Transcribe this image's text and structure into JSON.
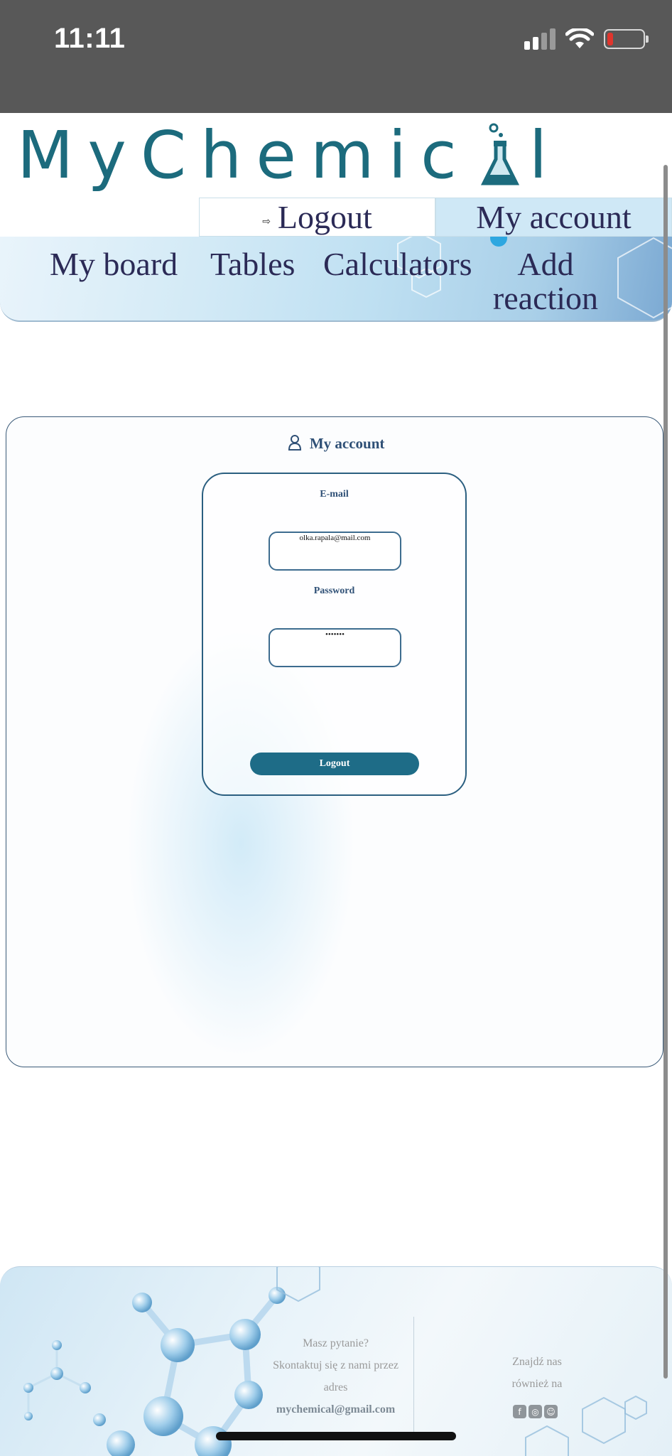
{
  "status_bar": {
    "time": "11:11"
  },
  "logo": {
    "text_before": "MyChemic",
    "text_after": "l"
  },
  "top_nav": {
    "logout_label": "Logout",
    "account_label": "My account"
  },
  "main_nav": {
    "my_board": "My board",
    "tables": "Tables",
    "calculators": "Calculators",
    "add_reaction_line1": "Add",
    "add_reaction_line2": "reaction"
  },
  "account": {
    "title": "My account",
    "email_label": "E-mail",
    "email_value": "olka.rapala@mail.com",
    "password_label": "Password",
    "password_value": "•••••••",
    "logout_button": "Logout"
  },
  "footer": {
    "question": "Masz pytanie?",
    "contact_line": "Skontaktuj się z nami przez",
    "address_word": "adres",
    "email": "mychemical@gmail.com",
    "find_line1": "Znajdź nas",
    "find_line2": "również na",
    "social_icons": [
      "facebook-icon",
      "instagram-icon",
      "snapchat-icon"
    ]
  },
  "colors": {
    "brand": "#1c6b7d",
    "nav_text": "#2b2a56",
    "button": "#1e6c87"
  }
}
